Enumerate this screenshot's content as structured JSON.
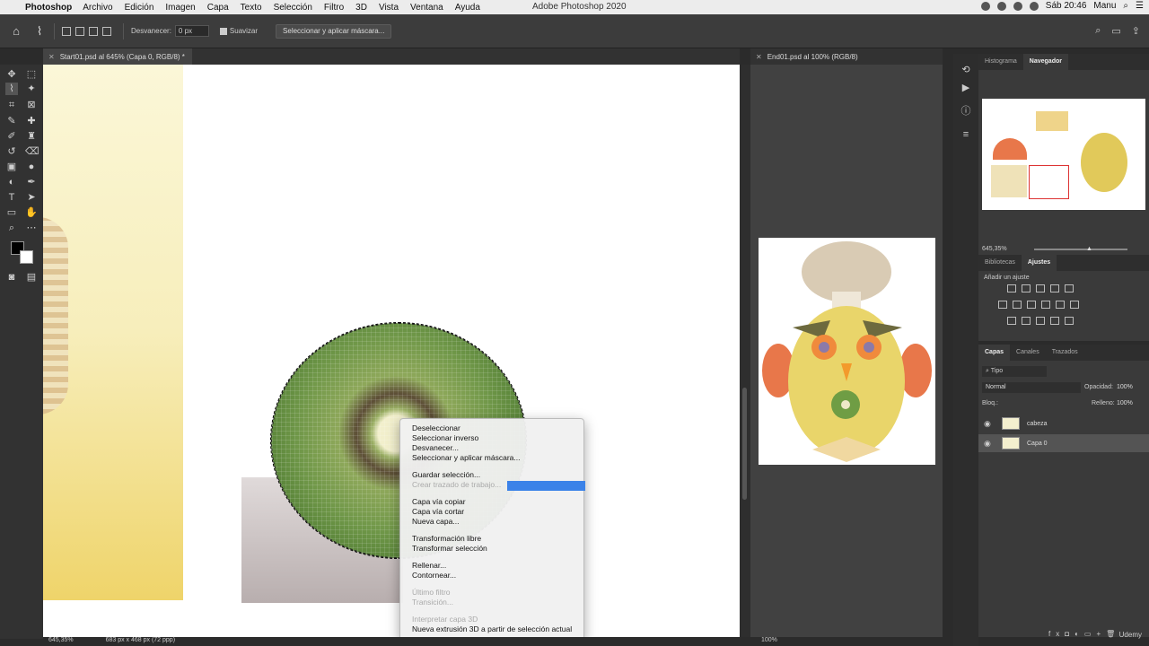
{
  "menubar": {
    "app": "Photoshop",
    "items": [
      "Archivo",
      "Edición",
      "Imagen",
      "Capa",
      "Texto",
      "Selección",
      "Filtro",
      "3D",
      "Vista",
      "Ventana",
      "Ayuda"
    ],
    "title": "Adobe Photoshop 2020",
    "clock": "Sáb 20:46",
    "user": "Manu"
  },
  "options": {
    "feather_label": "Desvanecer:",
    "feather_value": "0 px",
    "smooth_label": "Suavizar",
    "mask_button": "Seleccionar y aplicar máscara..."
  },
  "tabs": {
    "doc1": "Start01.psd al 645% (Capa 0, RGB/8) *",
    "doc2": "End01.psd al 100% (RGB/8)"
  },
  "context_menu": {
    "items": [
      {
        "label": "Deseleccionar",
        "disabled": false
      },
      {
        "label": "Seleccionar inverso",
        "disabled": false
      },
      {
        "label": "Desvanecer...",
        "disabled": false
      },
      {
        "label": "Seleccionar y aplicar máscara...",
        "disabled": false
      },
      {
        "label": "Guardar selección...",
        "disabled": false
      },
      {
        "label": "Crear trazado de trabajo...",
        "disabled": true
      },
      {
        "label": "Capa vía copiar",
        "disabled": false
      },
      {
        "label": "Capa vía cortar",
        "disabled": false
      },
      {
        "label": "Nueva capa...",
        "disabled": false
      },
      {
        "label": "Transformación libre",
        "disabled": false
      },
      {
        "label": "Transformar selección",
        "disabled": false
      },
      {
        "label": "Rellenar...",
        "disabled": false
      },
      {
        "label": "Contornear...",
        "disabled": false
      },
      {
        "label": "Último filtro",
        "disabled": true
      },
      {
        "label": "Transición...",
        "disabled": true
      },
      {
        "label": "Interpretar capa 3D",
        "disabled": true
      },
      {
        "label": "Nueva extrusión 3D a partir de selección actual",
        "disabled": false
      }
    ]
  },
  "status": {
    "zoom1": "645,35%",
    "docsize": "683 px x 468 px (72 ppp)",
    "zoom2": "100%"
  },
  "panels": {
    "nav_tabs": [
      "Histograma",
      "Navegador"
    ],
    "nav_zoom": "645,35%",
    "adj_tabs": [
      "Bibliotecas",
      "Ajustes"
    ],
    "adj_hint": "Añadir un ajuste",
    "layer_tabs": [
      "Capas",
      "Canales",
      "Trazados"
    ],
    "kind_label": "Tipo",
    "blend_mode": "Normal",
    "opacity_label": "Opacidad:",
    "opacity_value": "100%",
    "lock_label": "Bloq.:",
    "fill_label": "Relleno:",
    "fill_value": "100%",
    "layers": [
      "cabeza",
      "Capa 0"
    ]
  },
  "watermarks": {
    "brand": "Udemy"
  },
  "colors": {
    "menu_highlight": "#3b82e8",
    "panel_bg": "#3a3a3a",
    "app_bg": "#2b2b2b"
  }
}
